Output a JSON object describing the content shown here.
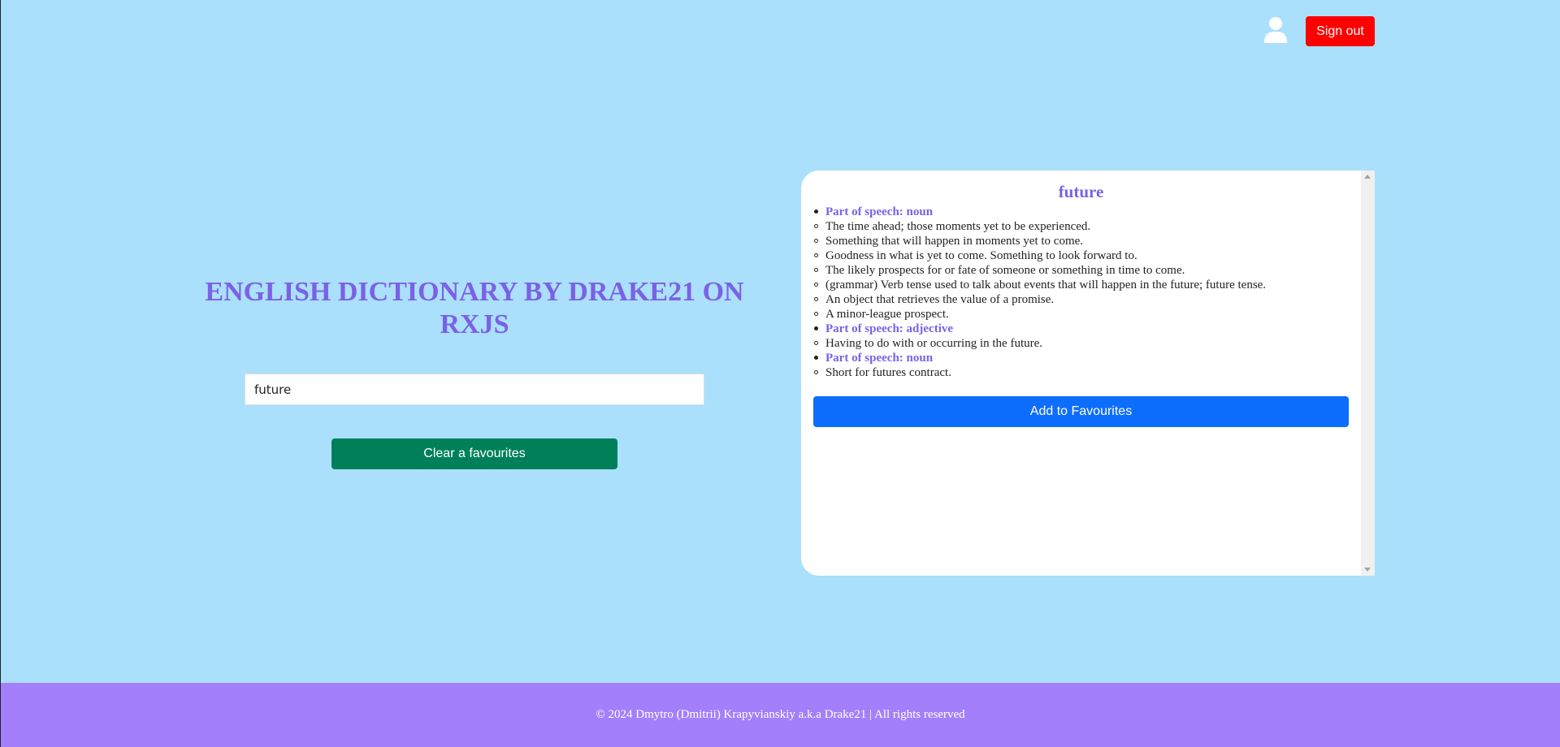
{
  "header": {
    "user_icon": "user-icon",
    "sign_out_label": "Sign out",
    "sign_out_color": "#ff0000"
  },
  "main": {
    "title": "ENGLISH DICTIONARY BY DRAKE21 ON RXJS",
    "search_value": "future",
    "clear_button_label": "Clear a favourites",
    "clear_button_color": "#00805a"
  },
  "result": {
    "word": "future",
    "entries": [
      {
        "type": "pos",
        "text": "Part of speech: noun"
      },
      {
        "type": "def",
        "text": "The time ahead; those moments yet to be experienced."
      },
      {
        "type": "def",
        "text": "Something that will happen in moments yet to come."
      },
      {
        "type": "def",
        "text": "Goodness in what is yet to come. Something to look forward to."
      },
      {
        "type": "def",
        "text": "The likely prospects for or fate of someone or something in time to come."
      },
      {
        "type": "def",
        "text": "(grammar) Verb tense used to talk about events that will happen in the future; future tense."
      },
      {
        "type": "def",
        "text": "An object that retrieves the value of a promise."
      },
      {
        "type": "def",
        "text": "A minor-league prospect."
      },
      {
        "type": "pos",
        "text": "Part of speech: adjective"
      },
      {
        "type": "def",
        "text": "Having to do with or occurring in the future."
      },
      {
        "type": "pos",
        "text": "Part of speech: noun"
      },
      {
        "type": "def",
        "text": "Short for futures contract."
      }
    ],
    "add_button_label": "Add to Favourites",
    "add_button_color": "#0d6efd"
  },
  "footer": {
    "text": "© 2024 Dmytro (Dmitrii) Krapyvianskiy a.k.a Drake21 | All rights reserved"
  },
  "colors": {
    "page_background": "#aae0fc",
    "accent_purple": "#7b61e6",
    "footer_background": "#a47ffb"
  }
}
